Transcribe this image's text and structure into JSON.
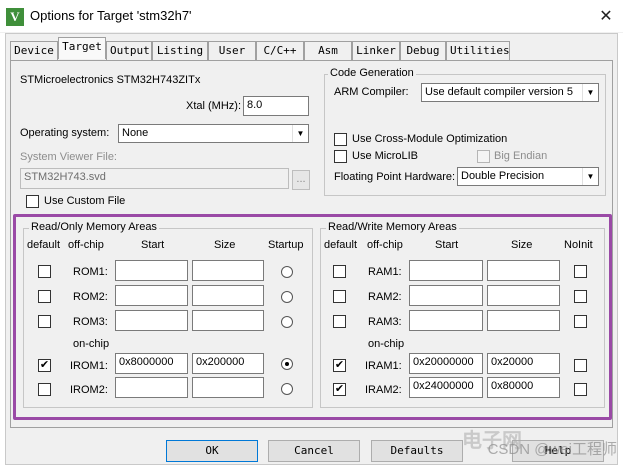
{
  "window": {
    "title": "Options for Target 'stm32h7'",
    "close_glyph": "✕",
    "icon_letter": "V"
  },
  "tabs": [
    {
      "label": "Device"
    },
    {
      "label": "Target"
    },
    {
      "label": "Output"
    },
    {
      "label": "Listing"
    },
    {
      "label": "User"
    },
    {
      "label": "C/C++"
    },
    {
      "label": "Asm"
    },
    {
      "label": "Linker"
    },
    {
      "label": "Debug"
    },
    {
      "label": "Utilities"
    }
  ],
  "active_tab": "Target",
  "device": {
    "name": "STMicroelectronics STM32H743ZITx",
    "xtal_label": "Xtal (MHz):",
    "xtal_value": "8.0",
    "os_label": "Operating system:",
    "os_value": "None",
    "svf_label": "System Viewer File:",
    "svf_value": "STM32H743.svd",
    "browse_label": "...",
    "custom_file_label": "Use Custom File",
    "custom_file_checked": false
  },
  "code_gen": {
    "title": "Code Generation",
    "compiler_label": "ARM Compiler:",
    "compiler_value": "Use default compiler version 5",
    "cross_module_label": "Use Cross-Module Optimization",
    "microlib_label": "Use MicroLIB",
    "big_endian_label": "Big Endian",
    "fph_label": "Floating Point Hardware:",
    "fph_value": "Double Precision"
  },
  "ro_memory": {
    "title": "Read/Only Memory Areas",
    "headers": {
      "default": "default",
      "offchip": "off-chip",
      "start": "Start",
      "size": "Size",
      "startup": "Startup"
    },
    "onchip_label": "on-chip",
    "rows": [
      {
        "name": "ROM1:",
        "start": "",
        "size": "",
        "default": false,
        "startup": false
      },
      {
        "name": "ROM2:",
        "start": "",
        "size": "",
        "default": false,
        "startup": false
      },
      {
        "name": "ROM3:",
        "start": "",
        "size": "",
        "default": false,
        "startup": false
      },
      {
        "name": "IROM1:",
        "start": "0x8000000",
        "size": "0x200000",
        "default": true,
        "startup": true
      },
      {
        "name": "IROM2:",
        "start": "",
        "size": "",
        "default": false,
        "startup": false
      }
    ]
  },
  "rw_memory": {
    "title": "Read/Write Memory Areas",
    "headers": {
      "default": "default",
      "offchip": "off-chip",
      "start": "Start",
      "size": "Size",
      "noinit": "NoInit"
    },
    "onchip_label": "on-chip",
    "rows": [
      {
        "name": "RAM1:",
        "start": "",
        "size": "",
        "default": false,
        "noinit": false
      },
      {
        "name": "RAM2:",
        "start": "",
        "size": "",
        "default": false,
        "noinit": false
      },
      {
        "name": "RAM3:",
        "start": "",
        "size": "",
        "default": false,
        "noinit": false
      },
      {
        "name": "IRAM1:",
        "start": "0x20000000",
        "size": "0x20000",
        "default": true,
        "noinit": false
      },
      {
        "name": "IRAM2:",
        "start": "0x24000000",
        "size": "0x80000",
        "default": true,
        "noinit": false
      }
    ]
  },
  "buttons": {
    "ok": "OK",
    "cancel": "Cancel",
    "defaults": "Defaults",
    "help": "Help"
  },
  "watermark": {
    "text": "CSDN @wei工程师",
    "brand": "电子网"
  },
  "colors": {
    "highlight": "#9a4aa6",
    "dialog_bg": "#f0f0f0"
  }
}
